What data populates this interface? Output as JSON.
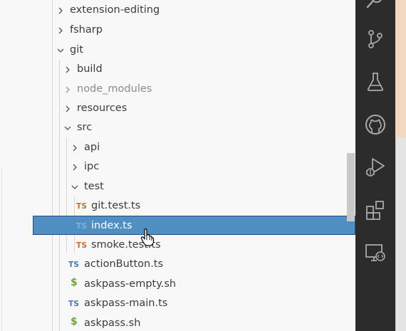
{
  "explorer": {
    "items": [
      {
        "label": "extension-editing",
        "kind": "folder",
        "expanded": false
      },
      {
        "label": "fsharp",
        "kind": "folder",
        "expanded": false
      },
      {
        "label": "git",
        "kind": "folder",
        "expanded": true
      },
      {
        "label": "build",
        "kind": "folder",
        "expanded": false
      },
      {
        "label": "node_modules",
        "kind": "folder",
        "expanded": false,
        "dimmed": true
      },
      {
        "label": "resources",
        "kind": "folder",
        "expanded": false
      },
      {
        "label": "src",
        "kind": "folder",
        "expanded": true
      },
      {
        "label": "api",
        "kind": "folder",
        "expanded": false
      },
      {
        "label": "ipc",
        "kind": "folder",
        "expanded": false
      },
      {
        "label": "test",
        "kind": "folder",
        "expanded": true
      },
      {
        "label": "git.test.ts",
        "kind": "file",
        "badge": "TS"
      },
      {
        "label": "index.ts",
        "kind": "file",
        "badge": "TS",
        "selected": true
      },
      {
        "label": "smoke.test.ts",
        "kind": "file",
        "badge": "TS"
      },
      {
        "label": "actionButton.ts",
        "kind": "file",
        "badge": "TS"
      },
      {
        "label": "askpass-empty.sh",
        "kind": "file",
        "badge": "$"
      },
      {
        "label": "askpass-main.ts",
        "kind": "file",
        "badge": "TS"
      },
      {
        "label": "askpass.sh",
        "kind": "file",
        "badge": "$"
      }
    ]
  },
  "activity_bar": {
    "icons": [
      "search-icon",
      "source-control-icon",
      "testing-icon",
      "github-icon",
      "run-debug-icon",
      "extensions-icon",
      "remote-explorer-icon"
    ]
  },
  "colors": {
    "selection": "#4f8fc2",
    "selection_border": "#1f4f84",
    "ts_badge": "#cf6a29",
    "shell_badge": "#71a539",
    "activity_bar": "#2c2c2c",
    "explorer_bg": "#f8f8f8"
  }
}
